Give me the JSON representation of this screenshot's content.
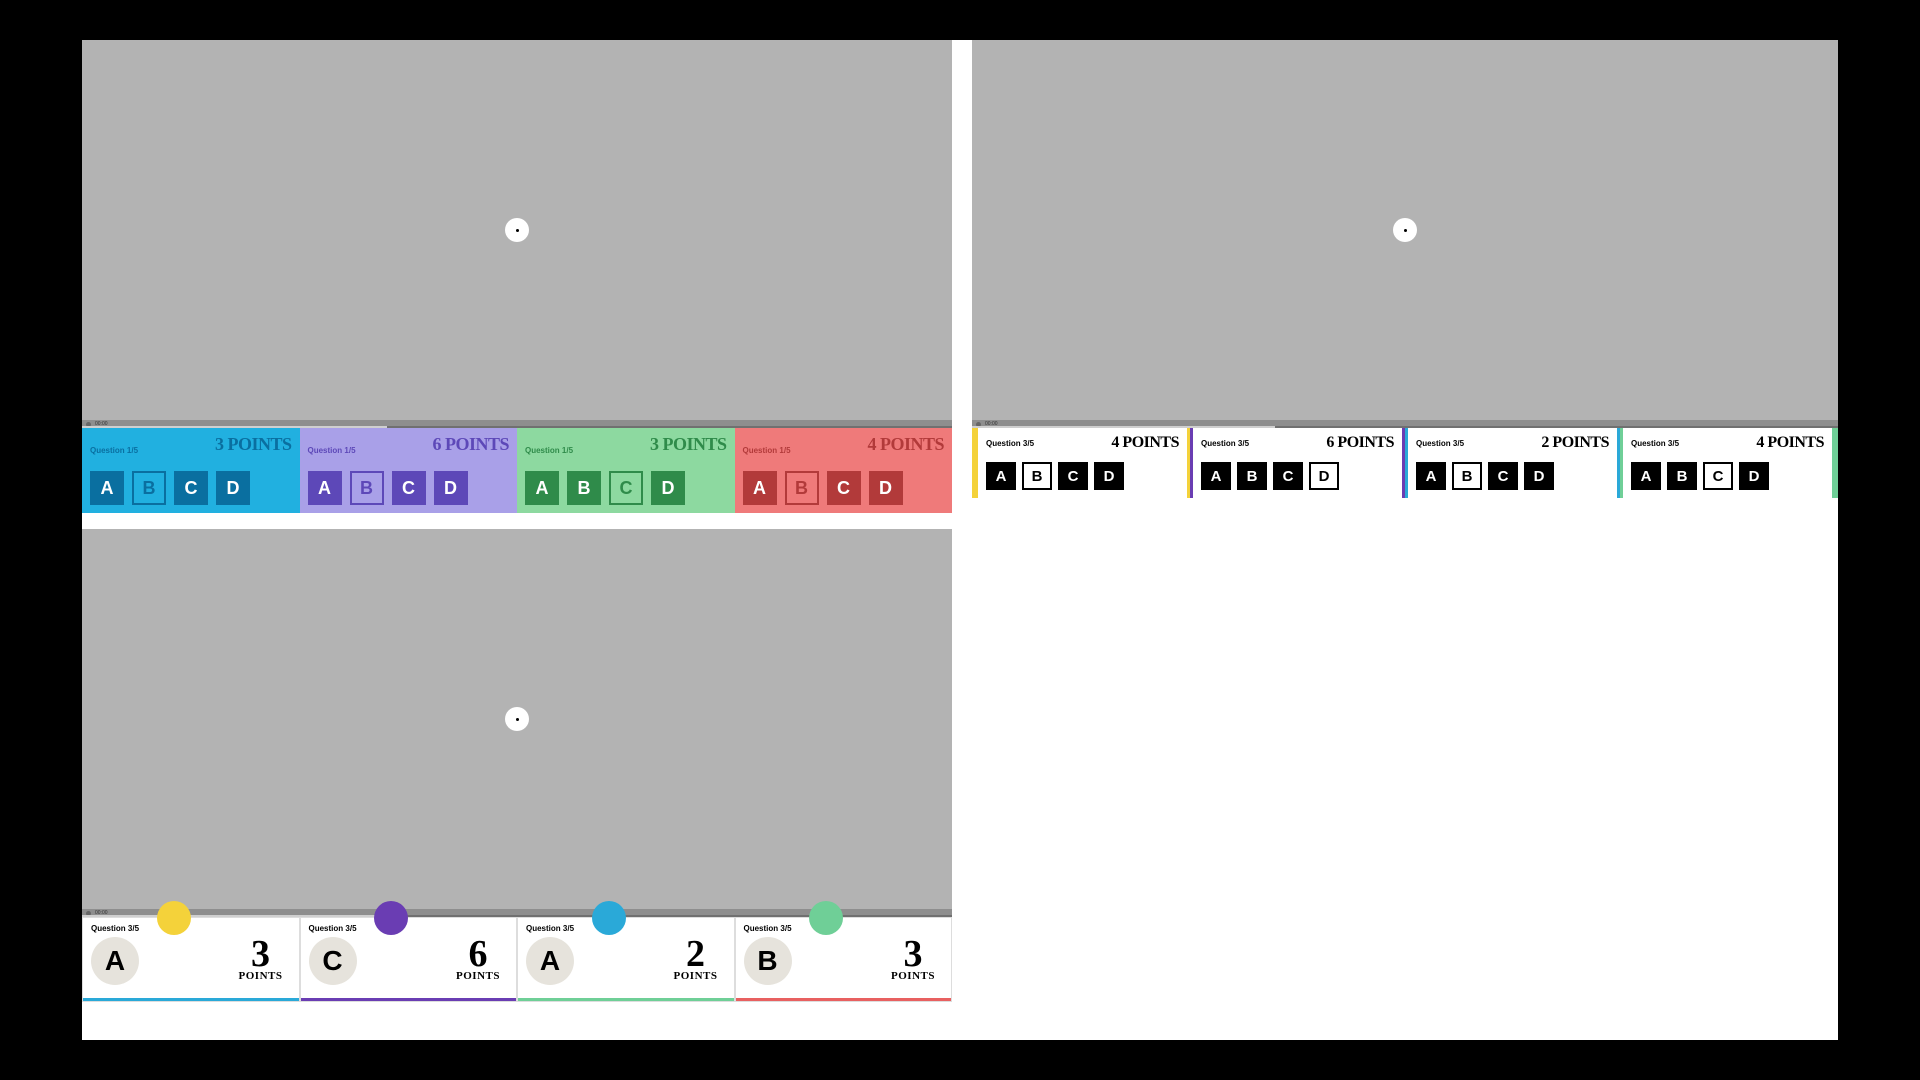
{
  "options": [
    "A",
    "B",
    "C",
    "D"
  ],
  "colors": {
    "yellow": "#f4d23a",
    "purple": "#6a3db3",
    "teal": "#2aa9d8",
    "green": "#6fcf97",
    "red": "#e86060",
    "lilac": "#a9a0e8",
    "mint": "#8dd9a0",
    "skyblue": "#21b0e0"
  },
  "mockA": {
    "timecode": "00:00",
    "panels": [
      {
        "q": "Question 1/5",
        "points": "3 POINTS",
        "bg": "#21b0e0",
        "btn": "#0a6fa0",
        "sel": "B"
      },
      {
        "q": "Question 1/5",
        "points": "6 POINTS",
        "bg": "#a9a0e8",
        "btn": "#5d48b8",
        "sel": "B"
      },
      {
        "q": "Question 1/5",
        "points": "3 POINTS",
        "bg": "#8dd9a0",
        "btn": "#2f8b4a",
        "sel": "C"
      },
      {
        "q": "Question 1/5",
        "points": "4 POINTS",
        "bg": "#ef7a7a",
        "btn": "#b23a3a",
        "sel": "B"
      }
    ]
  },
  "mockB": {
    "timecode": "00:00",
    "panels": [
      {
        "q": "Question 3/5",
        "points": "4 POINTS",
        "edges": [
          "#f4d23a"
        ],
        "sel": "B"
      },
      {
        "q": "Question 3/5",
        "points": "6 POINTS",
        "edges": [
          "#f4d23a",
          "#6a3db3"
        ],
        "sel": "D"
      },
      {
        "q": "Question 3/5",
        "points": "2 POINTS",
        "edges": [
          "#6a3db3",
          "#2aa9d8"
        ],
        "sel": "B"
      },
      {
        "q": "Question 3/5",
        "points": "4 POINTS",
        "edges": [
          "#2aa9d8",
          "#6fcf97"
        ],
        "sel": "C",
        "endEdge": "#6fcf97"
      }
    ]
  },
  "mockC": {
    "timecode": "00:00",
    "pointsLabel": "POINTS",
    "panels": [
      {
        "q": "Question 3/5",
        "letter": "A",
        "num": "3",
        "dot": "#f4d23a",
        "under": "#2aa9d8"
      },
      {
        "q": "Question 3/5",
        "letter": "C",
        "num": "6",
        "dot": "#6a3db3",
        "under": "#6a3db3"
      },
      {
        "q": "Question 3/5",
        "letter": "A",
        "num": "2",
        "dot": "#2aa9d8",
        "under": "#6fcf97"
      },
      {
        "q": "Question 3/5",
        "letter": "B",
        "num": "3",
        "dot": "#6fcf97",
        "under": "#e86060"
      }
    ]
  }
}
